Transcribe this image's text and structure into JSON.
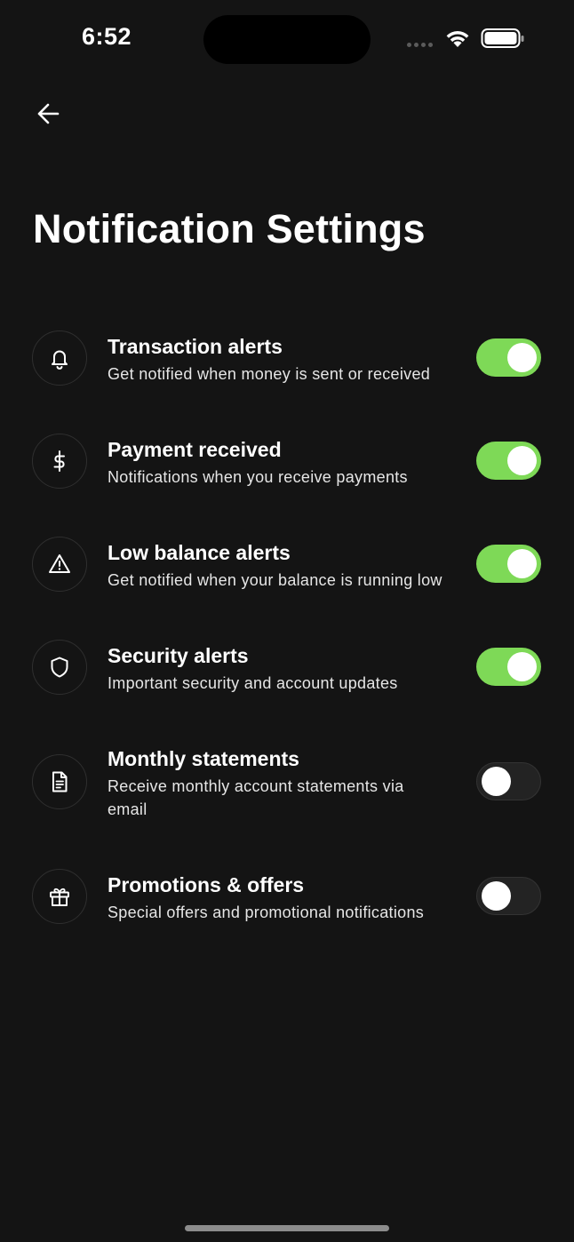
{
  "status_bar": {
    "time": "6:52"
  },
  "header": {
    "back_icon": "arrow-left-icon",
    "title": "Notification Settings"
  },
  "settings": [
    {
      "icon": "bell-icon",
      "title": "Transaction alerts",
      "description": "Get notified when money is sent or received",
      "enabled": true
    },
    {
      "icon": "dollar-icon",
      "title": "Payment received",
      "description": "Notifications when you receive payments",
      "enabled": true
    },
    {
      "icon": "warning-icon",
      "title": "Low balance alerts",
      "description": "Get notified when your balance is running low",
      "enabled": true
    },
    {
      "icon": "shield-icon",
      "title": "Security alerts",
      "description": "Important security and account updates",
      "enabled": true
    },
    {
      "icon": "document-icon",
      "title": "Monthly statements",
      "description": "Receive monthly account statements via email",
      "enabled": false
    },
    {
      "icon": "gift-icon",
      "title": "Promotions & offers",
      "description": "Special offers and promotional notifications",
      "enabled": false
    }
  ],
  "colors": {
    "background": "#141414",
    "toggle_on": "#7ed957",
    "toggle_off": "#232323"
  }
}
